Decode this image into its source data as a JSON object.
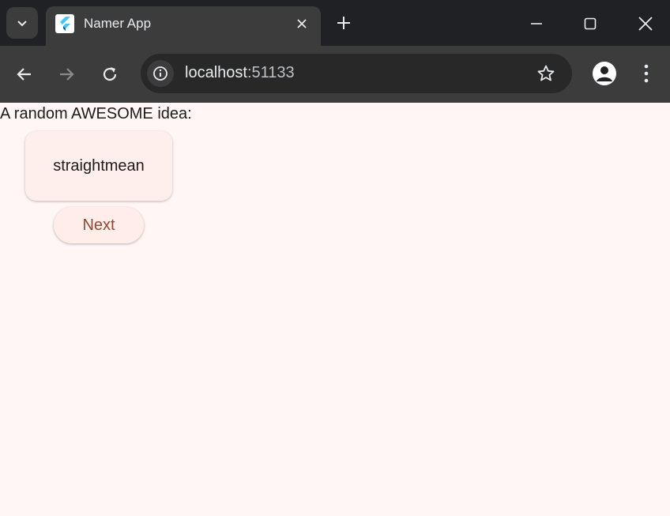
{
  "tab": {
    "title": "Namer App",
    "favicon": "flutter-logo-icon"
  },
  "toolbar": {
    "url_host": "localhost",
    "url_port": ":51133"
  },
  "icons": {
    "tab_search": "chevron-down-icon",
    "tab_close": "close-icon",
    "new_tab": "plus-icon",
    "minimize": "minimize-icon",
    "maximize": "maximize-icon",
    "close_window": "close-icon",
    "back": "arrow-left-icon",
    "forward": "arrow-right-icon",
    "reload": "reload-icon",
    "site_info": "info-icon",
    "bookmark": "star-icon",
    "profile": "person-icon",
    "menu": "more-vert-icon"
  },
  "colors": {
    "page_background": "#fff6f5",
    "card_background": "#ffefec",
    "button_text": "#8a4a36",
    "chrome_dark": "#202124",
    "chrome_toolbar": "#3c3c3c"
  },
  "page": {
    "intro_text": "A random AWESOME idea:",
    "word_pair": "straightmean",
    "next_label": "Next"
  }
}
